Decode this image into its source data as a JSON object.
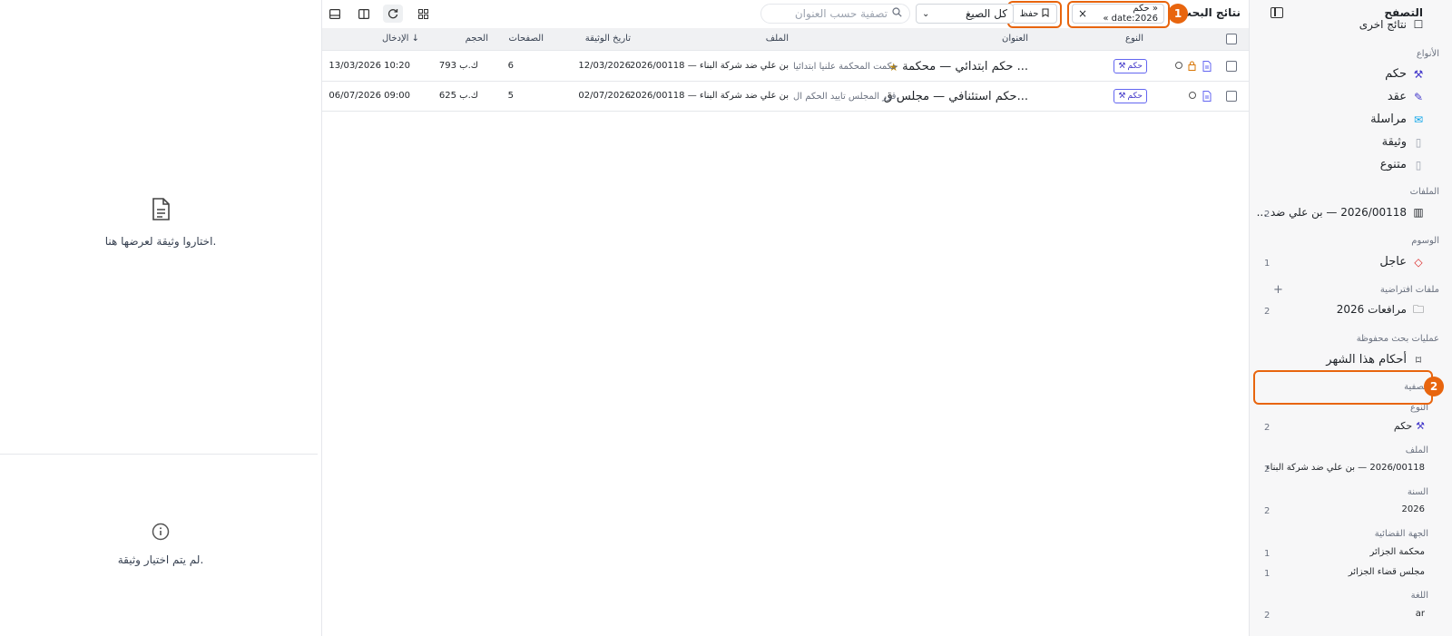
{
  "sidebar": {
    "title": "التصفح",
    "top_cut_label": "نتائج أخرى",
    "types_header": "الأنواع",
    "types": [
      {
        "label": "حكم",
        "icon": "gavel-icon"
      },
      {
        "label": "عقد",
        "icon": "contract-icon"
      },
      {
        "label": "مراسلة",
        "icon": "mail-icon"
      },
      {
        "label": "وثيقة",
        "icon": "document-icon"
      },
      {
        "label": "متنوع",
        "icon": "document-icon"
      }
    ],
    "files_header": "الملفات",
    "files": [
      {
        "label": "2026/00118 — بن علي ضد ...",
        "count": "2"
      }
    ],
    "tags_header": "الوسوم",
    "tags": [
      {
        "label": "عاجل",
        "count": "1"
      }
    ],
    "virtual_header": "ملفات افتراضية",
    "virtual_add": "+",
    "virtual": [
      {
        "label": "مرافعات 2026",
        "count": "2"
      }
    ],
    "saved_header": "عمليات بحث محفوظة",
    "saved": [
      {
        "label": "أحكام هذا الشهر"
      }
    ],
    "filter_header": "تصفية",
    "facets": [
      {
        "header": "النوع",
        "items": [
          {
            "label": "حكم",
            "count": "2"
          }
        ]
      },
      {
        "header": "الملف",
        "items": [
          {
            "label": "2026/00118 — بن علي ضد شركة البناء",
            "count": "2"
          }
        ]
      },
      {
        "header": "السنة",
        "items": [
          {
            "label": "2026",
            "count": "2"
          }
        ]
      },
      {
        "header": "الجهة القضائية",
        "items": [
          {
            "label": "محكمة الجزائر",
            "count": "1"
          },
          {
            "label": "مجلس قضاء الجزائر",
            "count": "1"
          }
        ]
      },
      {
        "header": "اللغة",
        "items": [
          {
            "label": "ar",
            "count": "2"
          }
        ]
      }
    ]
  },
  "toolbar": {
    "title": "نتائج البحث",
    "query_chip": "« حكم date:2026 »",
    "close_chip": "×",
    "save_label": "حفظ",
    "format_select": "كل الصيغ",
    "search_placeholder": "تصفية حسب العنوان"
  },
  "annotations": {
    "badge1": "1",
    "badge2": "2"
  },
  "table": {
    "headers": {
      "type": "النوع",
      "title": "العنوان",
      "file": "الملف",
      "doc_date": "تاريخ الوثيقة",
      "pages": "الصفحات",
      "size": "الحجم",
      "entry": "الإدخال ↓"
    },
    "rows": [
      {
        "type_tag": "حكم",
        "title": "حكم ابتدائي — محكمة ...",
        "snippet": "حكمت المحكمة علنيا ابتدائيا...",
        "file": "2026/00118 — بن علي ضد شركة البناء",
        "doc_date": "12/03/2026",
        "pages": "6",
        "size": "793 ك.ب",
        "entry": "13/03/2026 10:20",
        "starred": true,
        "locked": true
      },
      {
        "type_tag": "حكم",
        "title": "حكم استئنافي — مجلس ق...",
        "snippet": "قرر المجلس تأييد الحكم ال...",
        "file": "2026/00118 — بن علي ضد شركة البناء",
        "doc_date": "02/07/2026",
        "pages": "5",
        "size": "625 ك.ب",
        "entry": "06/07/2026 09:00",
        "starred": false,
        "locked": false
      }
    ]
  },
  "preview": {
    "select_msg": "اختاروا وثيقة لعرضها هنا.",
    "none_msg": "لم يتم اختيار وثيقة."
  },
  "colors": {
    "accent": "#e8650e",
    "tag": "#4338ca",
    "star": "#b8860b",
    "urgent_tag": "#dc2626"
  }
}
